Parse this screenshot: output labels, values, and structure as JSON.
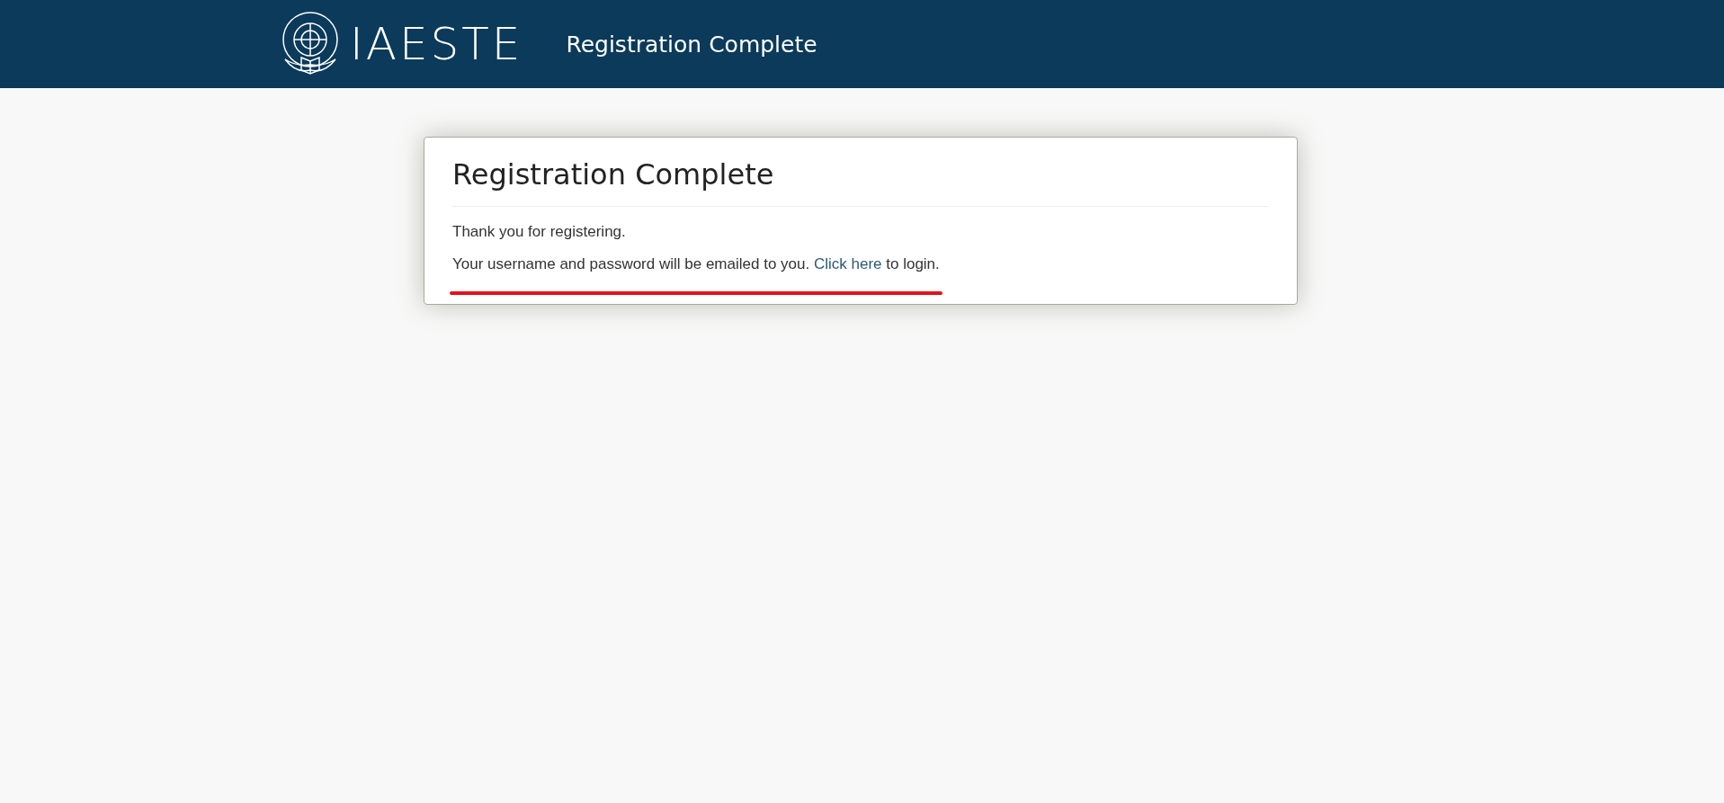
{
  "header": {
    "logo_text": "IAESTE",
    "title": "Registration Complete"
  },
  "card": {
    "title": "Registration Complete",
    "paragraphs": [
      {
        "kind": "plain",
        "text": "Thank you for registering."
      },
      {
        "kind": "link",
        "before": "Your username and password will be emailed to you. ",
        "link": "Click here",
        "after": " to login.",
        "underlined": true
      }
    ]
  }
}
